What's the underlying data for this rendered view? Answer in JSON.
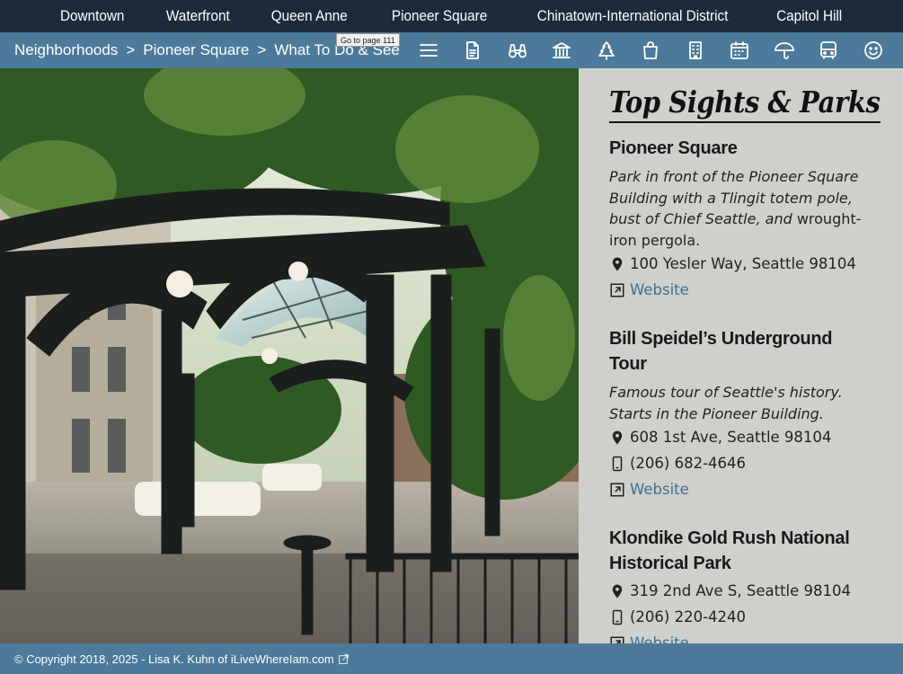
{
  "top_nav": [
    "Downtown",
    "Waterfront",
    "Queen Anne",
    "Pioneer Square",
    "Chinatown-International District",
    "Capitol Hill"
  ],
  "breadcrumb": {
    "items": [
      "Neighborhoods",
      "Pioneer Square",
      "What To Do & See"
    ],
    "separator": ">"
  },
  "tooltip": "Go to page 111",
  "toolbar_icons": [
    "menu-icon",
    "document-icon",
    "binoculars-icon",
    "museum-icon",
    "tree-icon",
    "shopping-bag-icon",
    "building-icon",
    "calendar-icon",
    "umbrella-icon",
    "bus-icon",
    "smiley-icon"
  ],
  "panel": {
    "title": "Top Sights & Parks",
    "sights": [
      {
        "name": "Pioneer Square",
        "desc_italic": "Park in front of the Pioneer Square Building with a Tlingit totem pole, bust of Chief Seattle, and",
        "desc_plain": " wrought-iron pergola.",
        "address": "100 Yesler Way, Seattle 98104",
        "phone": "",
        "website": "Website"
      },
      {
        "name": "Bill Speidel’s Underground Tour",
        "desc_italic": "Famous tour of Seattle's history. Starts in the Pioneer Building.",
        "desc_plain": "",
        "address": "608 1st Ave, Seattle 98104",
        "phone": "(206) 682-4646",
        "website": "Website"
      },
      {
        "name": "Klondike Gold Rush National Historical Park",
        "desc_italic": "",
        "desc_plain": "",
        "address": "319 2nd Ave S, Seattle 98104",
        "phone": "(206) 220-4240",
        "website": "Website"
      }
    ]
  },
  "footer": {
    "copyright": "© Copyright 2018, 2025 - Lisa K. Kuhn of iLiveWhereIam.com"
  },
  "colors": {
    "top_nav_bg": "#1e2a3b",
    "accent_bar": "#4b7a9b",
    "panel_bg": "#cfd0cb",
    "link": "#3f6f95"
  }
}
